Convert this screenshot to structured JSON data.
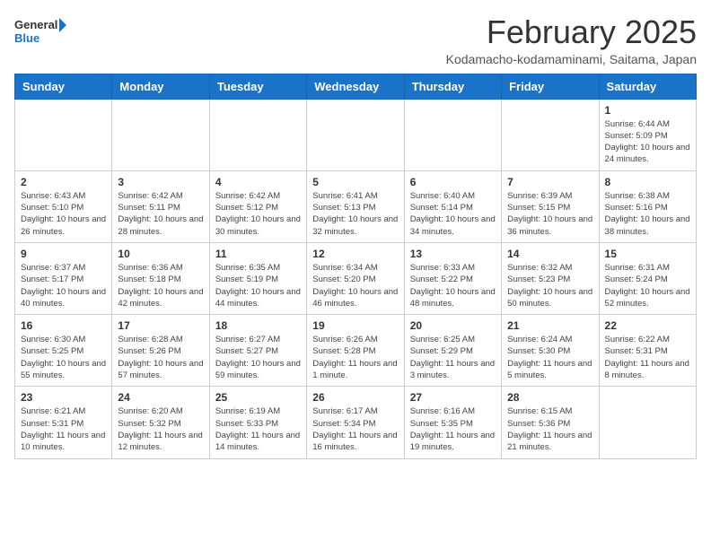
{
  "header": {
    "logo_line1": "General",
    "logo_line2": "Blue",
    "title": "February 2025",
    "subtitle": "Kodamacho-kodamaminami, Saitama, Japan"
  },
  "weekdays": [
    "Sunday",
    "Monday",
    "Tuesday",
    "Wednesday",
    "Thursday",
    "Friday",
    "Saturday"
  ],
  "weeks": [
    [
      {
        "day": "",
        "info": ""
      },
      {
        "day": "",
        "info": ""
      },
      {
        "day": "",
        "info": ""
      },
      {
        "day": "",
        "info": ""
      },
      {
        "day": "",
        "info": ""
      },
      {
        "day": "",
        "info": ""
      },
      {
        "day": "1",
        "info": "Sunrise: 6:44 AM\nSunset: 5:09 PM\nDaylight: 10 hours and 24 minutes."
      }
    ],
    [
      {
        "day": "2",
        "info": "Sunrise: 6:43 AM\nSunset: 5:10 PM\nDaylight: 10 hours and 26 minutes."
      },
      {
        "day": "3",
        "info": "Sunrise: 6:42 AM\nSunset: 5:11 PM\nDaylight: 10 hours and 28 minutes."
      },
      {
        "day": "4",
        "info": "Sunrise: 6:42 AM\nSunset: 5:12 PM\nDaylight: 10 hours and 30 minutes."
      },
      {
        "day": "5",
        "info": "Sunrise: 6:41 AM\nSunset: 5:13 PM\nDaylight: 10 hours and 32 minutes."
      },
      {
        "day": "6",
        "info": "Sunrise: 6:40 AM\nSunset: 5:14 PM\nDaylight: 10 hours and 34 minutes."
      },
      {
        "day": "7",
        "info": "Sunrise: 6:39 AM\nSunset: 5:15 PM\nDaylight: 10 hours and 36 minutes."
      },
      {
        "day": "8",
        "info": "Sunrise: 6:38 AM\nSunset: 5:16 PM\nDaylight: 10 hours and 38 minutes."
      }
    ],
    [
      {
        "day": "9",
        "info": "Sunrise: 6:37 AM\nSunset: 5:17 PM\nDaylight: 10 hours and 40 minutes."
      },
      {
        "day": "10",
        "info": "Sunrise: 6:36 AM\nSunset: 5:18 PM\nDaylight: 10 hours and 42 minutes."
      },
      {
        "day": "11",
        "info": "Sunrise: 6:35 AM\nSunset: 5:19 PM\nDaylight: 10 hours and 44 minutes."
      },
      {
        "day": "12",
        "info": "Sunrise: 6:34 AM\nSunset: 5:20 PM\nDaylight: 10 hours and 46 minutes."
      },
      {
        "day": "13",
        "info": "Sunrise: 6:33 AM\nSunset: 5:22 PM\nDaylight: 10 hours and 48 minutes."
      },
      {
        "day": "14",
        "info": "Sunrise: 6:32 AM\nSunset: 5:23 PM\nDaylight: 10 hours and 50 minutes."
      },
      {
        "day": "15",
        "info": "Sunrise: 6:31 AM\nSunset: 5:24 PM\nDaylight: 10 hours and 52 minutes."
      }
    ],
    [
      {
        "day": "16",
        "info": "Sunrise: 6:30 AM\nSunset: 5:25 PM\nDaylight: 10 hours and 55 minutes."
      },
      {
        "day": "17",
        "info": "Sunrise: 6:28 AM\nSunset: 5:26 PM\nDaylight: 10 hours and 57 minutes."
      },
      {
        "day": "18",
        "info": "Sunrise: 6:27 AM\nSunset: 5:27 PM\nDaylight: 10 hours and 59 minutes."
      },
      {
        "day": "19",
        "info": "Sunrise: 6:26 AM\nSunset: 5:28 PM\nDaylight: 11 hours and 1 minute."
      },
      {
        "day": "20",
        "info": "Sunrise: 6:25 AM\nSunset: 5:29 PM\nDaylight: 11 hours and 3 minutes."
      },
      {
        "day": "21",
        "info": "Sunrise: 6:24 AM\nSunset: 5:30 PM\nDaylight: 11 hours and 5 minutes."
      },
      {
        "day": "22",
        "info": "Sunrise: 6:22 AM\nSunset: 5:31 PM\nDaylight: 11 hours and 8 minutes."
      }
    ],
    [
      {
        "day": "23",
        "info": "Sunrise: 6:21 AM\nSunset: 5:31 PM\nDaylight: 11 hours and 10 minutes."
      },
      {
        "day": "24",
        "info": "Sunrise: 6:20 AM\nSunset: 5:32 PM\nDaylight: 11 hours and 12 minutes."
      },
      {
        "day": "25",
        "info": "Sunrise: 6:19 AM\nSunset: 5:33 PM\nDaylight: 11 hours and 14 minutes."
      },
      {
        "day": "26",
        "info": "Sunrise: 6:17 AM\nSunset: 5:34 PM\nDaylight: 11 hours and 16 minutes."
      },
      {
        "day": "27",
        "info": "Sunrise: 6:16 AM\nSunset: 5:35 PM\nDaylight: 11 hours and 19 minutes."
      },
      {
        "day": "28",
        "info": "Sunrise: 6:15 AM\nSunset: 5:36 PM\nDaylight: 11 hours and 21 minutes."
      },
      {
        "day": "",
        "info": ""
      }
    ]
  ]
}
